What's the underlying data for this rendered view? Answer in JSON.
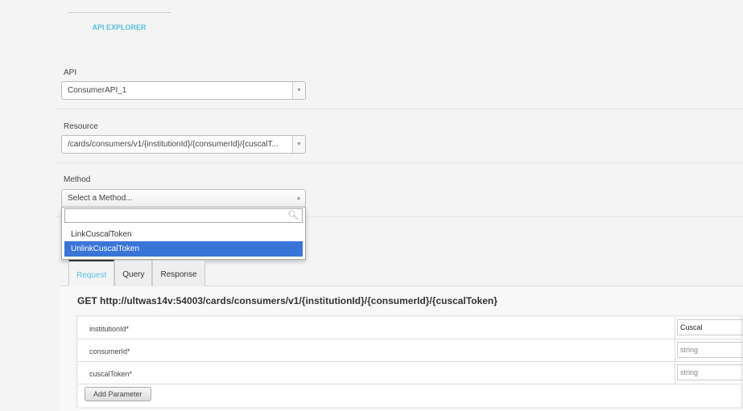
{
  "header": {
    "title": "API EXPLORER"
  },
  "api": {
    "label": "API",
    "value": "ConsumerAPI_1"
  },
  "resource": {
    "label": "Resource",
    "value": "/cards/consumers/v1/{institutionId}/{consumerId}/{cuscalT..."
  },
  "method": {
    "label": "Method",
    "placeholder": "Select a Method...",
    "search_value": "",
    "options": [
      "LinkCuscalToken",
      "UnlinkCuscalToken"
    ],
    "highlighted": 1
  },
  "tabs": [
    "Request",
    "Query",
    "Response"
  ],
  "request": {
    "line": "GET http://ultwas14v:54003/cards/consumers/v1/{institutionId}/{consumerId}/{cuscalToken}",
    "params": [
      {
        "name": "institutionId*",
        "value": "Cuscal"
      },
      {
        "name": "consumerId*",
        "value": "string"
      },
      {
        "name": "cuscalToken*",
        "value": "string"
      }
    ],
    "add_label": "Add Parameter"
  }
}
